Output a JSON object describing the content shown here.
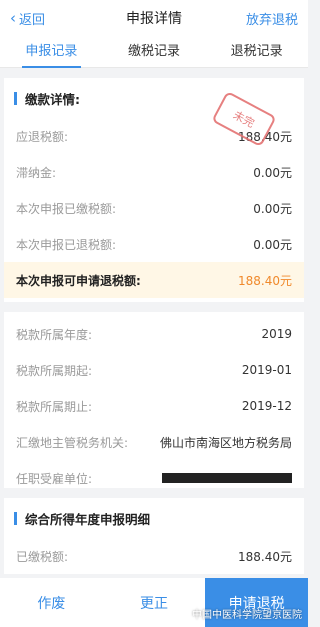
{
  "nav": {
    "back_label": "返回",
    "title": "申报详情",
    "right_label": "放弃退税"
  },
  "tabs": [
    {
      "label": "申报记录",
      "active": true
    },
    {
      "label": "缴税记录",
      "active": false
    },
    {
      "label": "退税记录",
      "active": false
    }
  ],
  "payment_detail": {
    "header": "缴款详情:",
    "stamp_text": "未完",
    "rows": [
      {
        "label": "应退税额:",
        "value": "188.40元"
      },
      {
        "label": "滞纳金:",
        "value": "0.00元"
      },
      {
        "label": "本次申报已缴税额:",
        "value": "0.00元"
      },
      {
        "label": "本次申报已退税额:",
        "value": "0.00元"
      }
    ],
    "highlight": {
      "label": "本次申报可申请退税额:",
      "value": "188.40元"
    },
    "info_rows": [
      {
        "label": "税款所属年度:",
        "value": "2019"
      },
      {
        "label": "税款所属期起:",
        "value": "2019-01"
      },
      {
        "label": "税款所属期止:",
        "value": "2019-12"
      },
      {
        "label": "汇缴地主管税务机关:",
        "value": "佛山市南海区地方税务局"
      },
      {
        "label": "任职受雇单位:",
        "value": ""
      }
    ]
  },
  "annual_detail": {
    "header": "综合所得年度申报明细",
    "rows": [
      {
        "label": "已缴税额:",
        "value": "188.40元"
      }
    ]
  },
  "bottom_bar": {
    "void_label": "作废",
    "correct_label": "更正",
    "refund_label": "申请退税"
  },
  "watermark": {
    "text": "中国中医科学院望京医院"
  },
  "colors": {
    "accent": "#3a8ee6",
    "highlight_value": "#f0892b",
    "stamp": "#e26a6a"
  }
}
